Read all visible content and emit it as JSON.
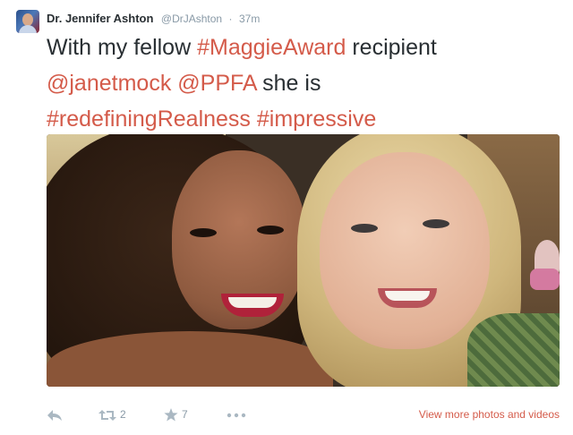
{
  "author": {
    "name": "Dr. Jennifer Ashton",
    "handle": "@DrJAshton",
    "separator": "·",
    "time": "37m"
  },
  "tweet": {
    "line1": {
      "text": "With my fellow ",
      "tag": "#MaggieAward",
      "text_after": " recipient"
    },
    "line2": {
      "mention1": "@janetmock",
      "space": " ",
      "mention2": "@PPFA",
      "text_after": " she is"
    },
    "line3": {
      "tag1": "#redefiningRealness",
      "space": " ",
      "tag2": "#impressive"
    }
  },
  "actions": {
    "reply_icon": "reply-icon",
    "retweet_icon": "retweet-icon",
    "retweet_count": "2",
    "favorite_icon": "star-icon",
    "favorite_count": "7",
    "more_icon": "more-dots-icon",
    "view_more_label": "View more photos and videos"
  },
  "colors": {
    "link": "#d45b4a",
    "text": "#292f33",
    "muted": "#8899a6",
    "icon": "#aab8c2"
  }
}
